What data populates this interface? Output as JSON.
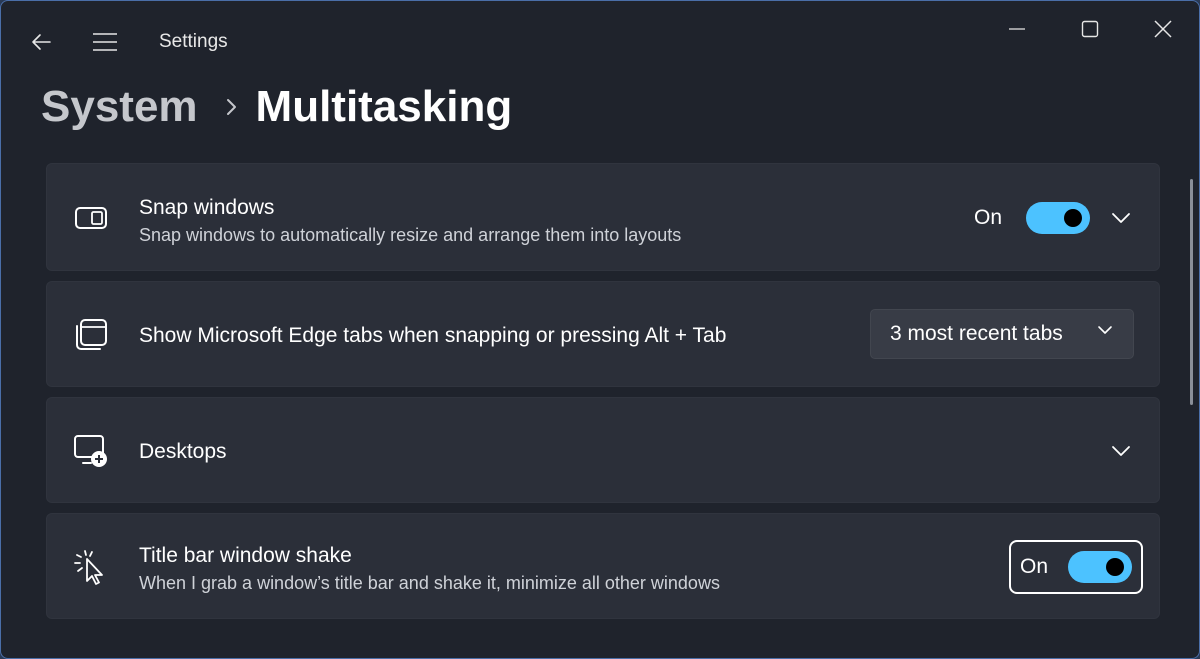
{
  "window": {
    "app_title": "Settings"
  },
  "breadcrumb": {
    "parent": "System",
    "current": "Multitasking"
  },
  "settings": {
    "snap_windows": {
      "title": "Snap windows",
      "description": "Snap windows to automatically resize and arrange them into layouts",
      "state_label": "On",
      "enabled": true,
      "icon": "snap-windows-icon"
    },
    "edge_tabs": {
      "title": "Show Microsoft Edge tabs when snapping or pressing Alt + Tab",
      "selected_value": "3 most recent tabs",
      "icon": "edge-tabs-icon"
    },
    "desktops": {
      "title": "Desktops",
      "icon": "desktops-icon"
    },
    "title_bar_shake": {
      "title": "Title bar window shake",
      "description": "When I grab a window’s title bar and shake it, minimize all other windows",
      "state_label": "On",
      "enabled": true,
      "icon": "shake-cursor-icon"
    }
  },
  "colors": {
    "accent": "#4cc2ff",
    "card": "#2b2f39",
    "background": "#1f232c"
  }
}
